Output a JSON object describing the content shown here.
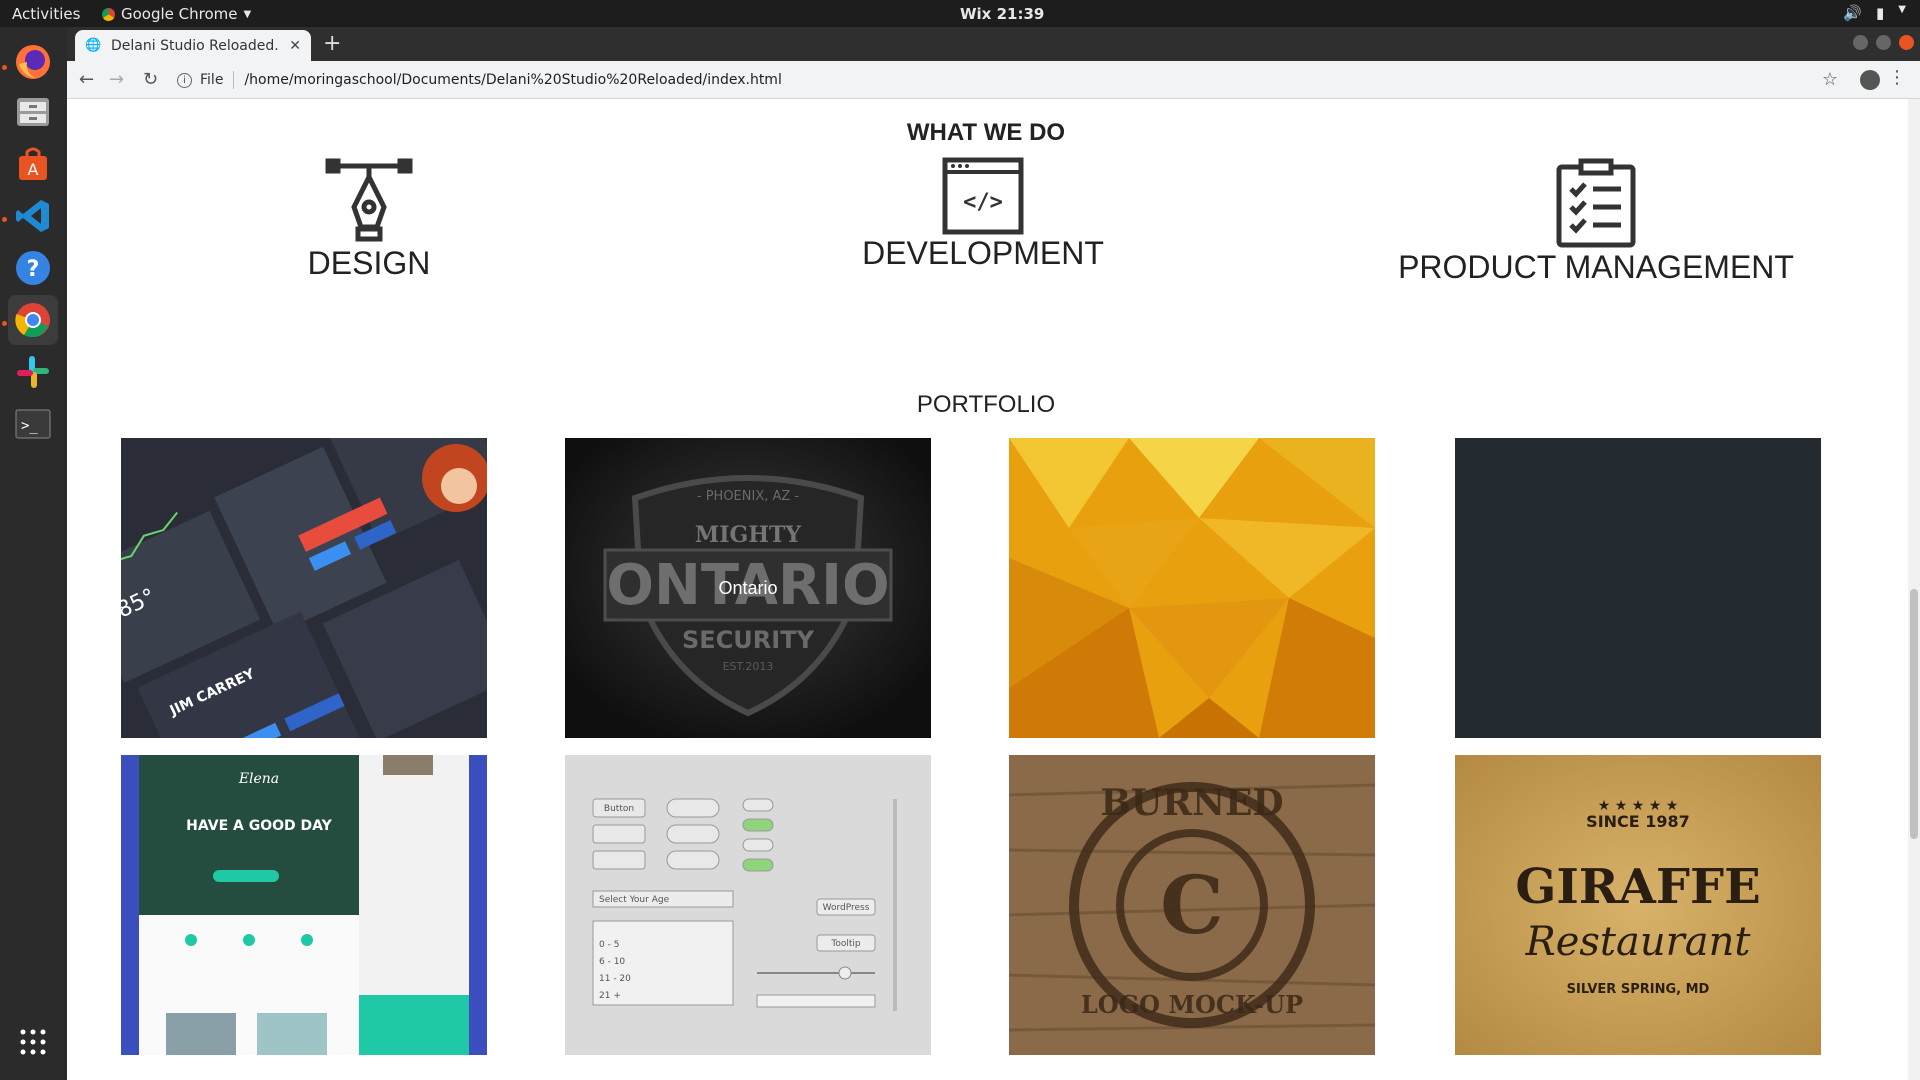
{
  "system": {
    "activities": "Activities",
    "app_name": "Google Chrome",
    "clock": "Wix 21:39"
  },
  "browser": {
    "tab_title": "Delani Studio Reloaded.",
    "scheme_label": "File",
    "url": "/home/moringaschool/Documents/Delani%20Studio%20Reloaded/index.html"
  },
  "page": {
    "section_title": "WHAT WE DO",
    "services": [
      {
        "label": "DESIGN",
        "icon": "pen-tool-icon"
      },
      {
        "label": "DEVELOPMENT",
        "icon": "code-window-icon"
      },
      {
        "label": "PRODUCT MANAGEMENT",
        "icon": "clipboard-checklist-icon"
      }
    ],
    "portfolio_title": "PORTFOLIO",
    "portfolio": [
      {
        "name": "ui-kit-dark",
        "label": ""
      },
      {
        "name": "mighty-ontario-badge",
        "label": "Ontario",
        "badge_top": "- PHOENIX, AZ -",
        "badge_mid": "MIGHTY",
        "badge_main": "ONTARIO",
        "badge_bottom": "SECURITY",
        "badge_est": "EST.2013"
      },
      {
        "name": "yellow-polygon",
        "label": ""
      },
      {
        "name": "dark-slate",
        "label": ""
      },
      {
        "name": "elena-template",
        "label": "",
        "headline": "HAVE A GOOD DAY",
        "brand": "Elena"
      },
      {
        "name": "ui-elements-light",
        "label": "",
        "button": "Button",
        "select": "Select Your Age",
        "options": [
          "0 - 5",
          "6 - 10",
          "11 - 20",
          "21 +"
        ],
        "tag": "WordPress",
        "tooltip": "Tooltip"
      },
      {
        "name": "burned-logo-mockup",
        "label": "",
        "top": "BURNED",
        "bottom": "LOGO MOCK-UP",
        "letter": "C"
      },
      {
        "name": "giraffe-restaurant",
        "label": "",
        "since": "SINCE 1987",
        "name1": "GIRAFFE",
        "name2": "Restaurant",
        "place": "SILVER SPRING, MD"
      }
    ]
  },
  "colors": {
    "accent": "#e95420",
    "dark_tile": "#232b30",
    "yellow_tile": "#e8a00e"
  }
}
